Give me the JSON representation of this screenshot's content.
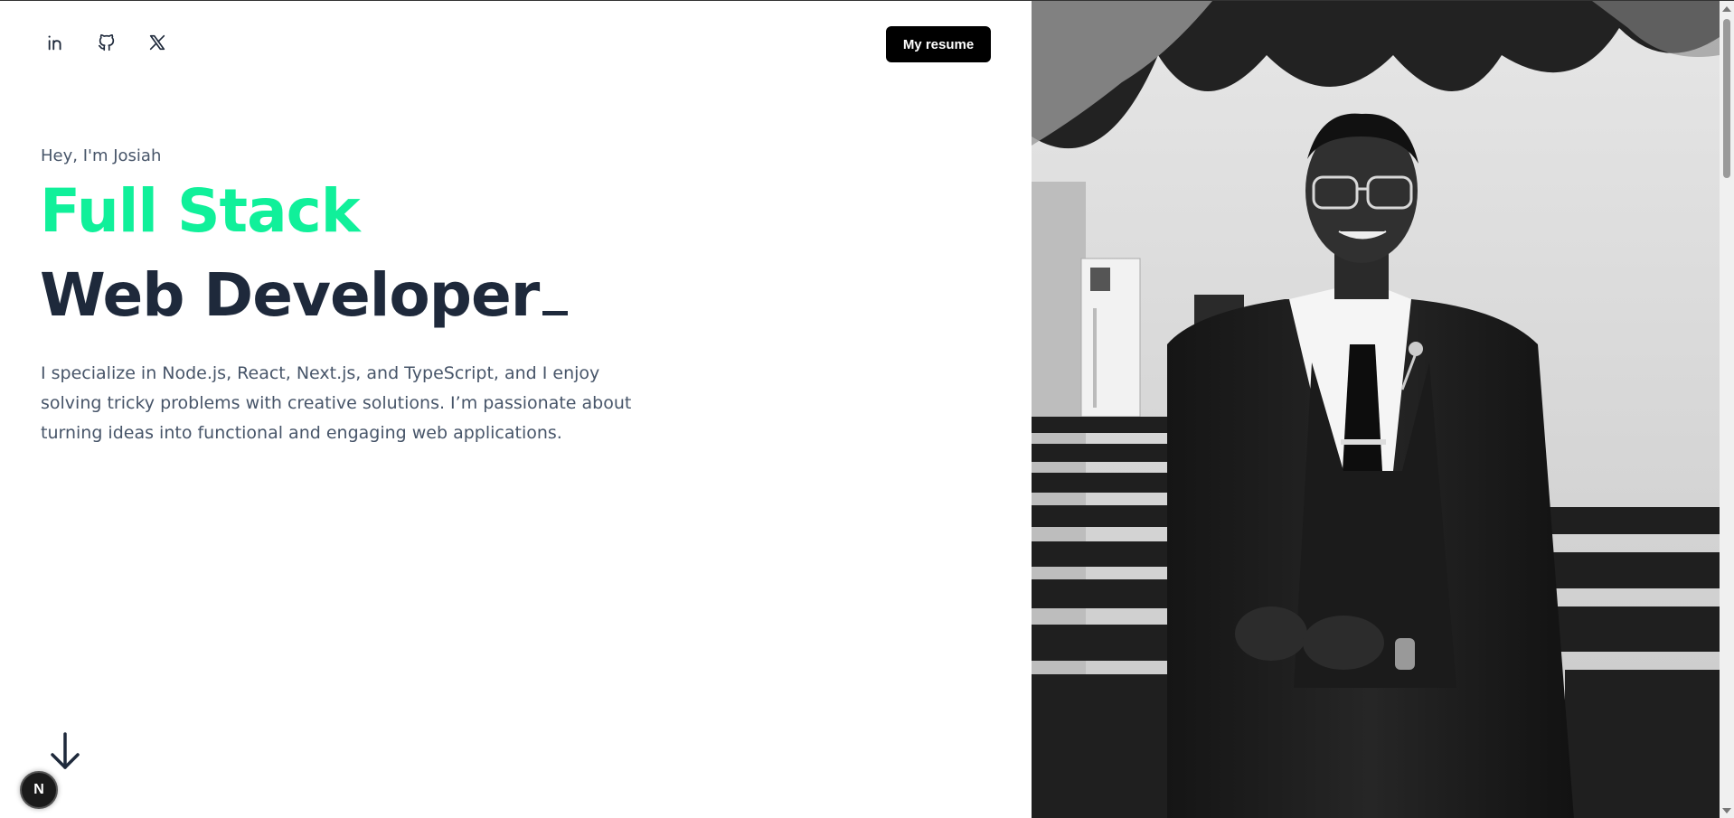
{
  "header": {
    "socials": [
      {
        "name": "linkedin",
        "icon": "linkedin-icon"
      },
      {
        "name": "github",
        "icon": "github-icon"
      },
      {
        "name": "x",
        "icon": "x-twitter-icon"
      }
    ],
    "resume_label": "My resume"
  },
  "hero": {
    "greeting": "Hey, I'm Josiah",
    "title_line1": "Full Stack",
    "title_line2": "Web Developer",
    "bio": "I specialize in Node.js, React, Next.js, and TypeScript, and I enjoy solving tricky problems with creative solutions. I’m passionate about turning ideas into functional and engaging web applications."
  },
  "badge": {
    "letter": "N"
  },
  "icons": {
    "scroll": "arrow-down-icon",
    "portrait": "profile-photo"
  },
  "colors": {
    "accent": "#10f09a",
    "heading": "#1e293b",
    "body_text": "#475569",
    "button_bg": "#000000"
  }
}
